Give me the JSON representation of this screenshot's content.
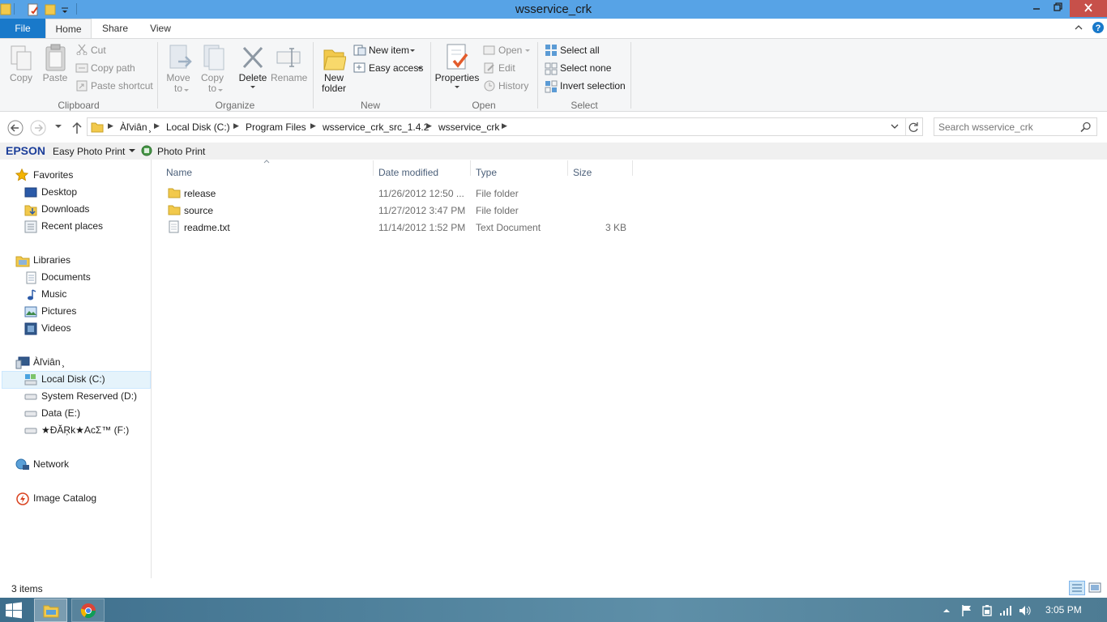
{
  "window": {
    "title": "wsservice_crk"
  },
  "ribbon_tabs": [
    "File",
    "Home",
    "Share",
    "View"
  ],
  "clipboard": {
    "copy": "Copy",
    "paste": "Paste",
    "cut": "Cut",
    "copy_path": "Copy path",
    "paste_shortcut": "Paste shortcut",
    "group": "Clipboard"
  },
  "organize": {
    "move_to": "Move to",
    "copy_to": "Copy to",
    "delete": "Delete",
    "rename": "Rename",
    "group": "Organize"
  },
  "new": {
    "new_folder": "New folder",
    "new_item": "New item",
    "easy_access": "Easy access",
    "group": "New"
  },
  "open": {
    "properties": "Properties",
    "open": "Open",
    "edit": "Edit",
    "history": "History",
    "group": "Open"
  },
  "select": {
    "select_all": "Select all",
    "select_none": "Select none",
    "invert": "Invert selection",
    "group": "Select"
  },
  "breadcrumb": [
    "Àľviân ̧",
    "Local Disk (C:)",
    "Program Files",
    "wsservice_crk_src_1.4.2",
    "wsservice_crk"
  ],
  "search": {
    "placeholder": "Search wsservice_crk"
  },
  "epson": {
    "brand": "EPSON",
    "app": "Easy Photo Print",
    "photo_print": "Photo Print"
  },
  "nav": {
    "favorites": "Favorites",
    "desktop": "Desktop",
    "downloads": "Downloads",
    "recent": "Recent places",
    "libraries": "Libraries",
    "documents": "Documents",
    "music": "Music",
    "pictures": "Pictures",
    "videos": "Videos",
    "computer": "Àľviân ̧",
    "local_disk": "Local Disk (C:)",
    "system_reserved": "System Reserved (D:)",
    "data": "Data (E:)",
    "f_drive": "★ĐĂŖk★AcΣ™ (F:)",
    "network": "Network",
    "image_catalog": "Image Catalog"
  },
  "columns": {
    "name": "Name",
    "date": "Date modified",
    "type": "Type",
    "size": "Size"
  },
  "files": [
    {
      "name": "release",
      "date": "11/26/2012 12:50 ...",
      "type": "File folder",
      "size": ""
    },
    {
      "name": "source",
      "date": "11/27/2012 3:47 PM",
      "type": "File folder",
      "size": ""
    },
    {
      "name": "readme.txt",
      "date": "11/14/2012 1:52 PM",
      "type": "Text Document",
      "size": "3 KB"
    }
  ],
  "status": {
    "count": "3 items"
  },
  "taskbar": {
    "time": "3:05 PM"
  },
  "colors": {
    "titlebar": "#57a3e6",
    "file_tab": "#1979ca",
    "selection": "#e5f3fb"
  }
}
